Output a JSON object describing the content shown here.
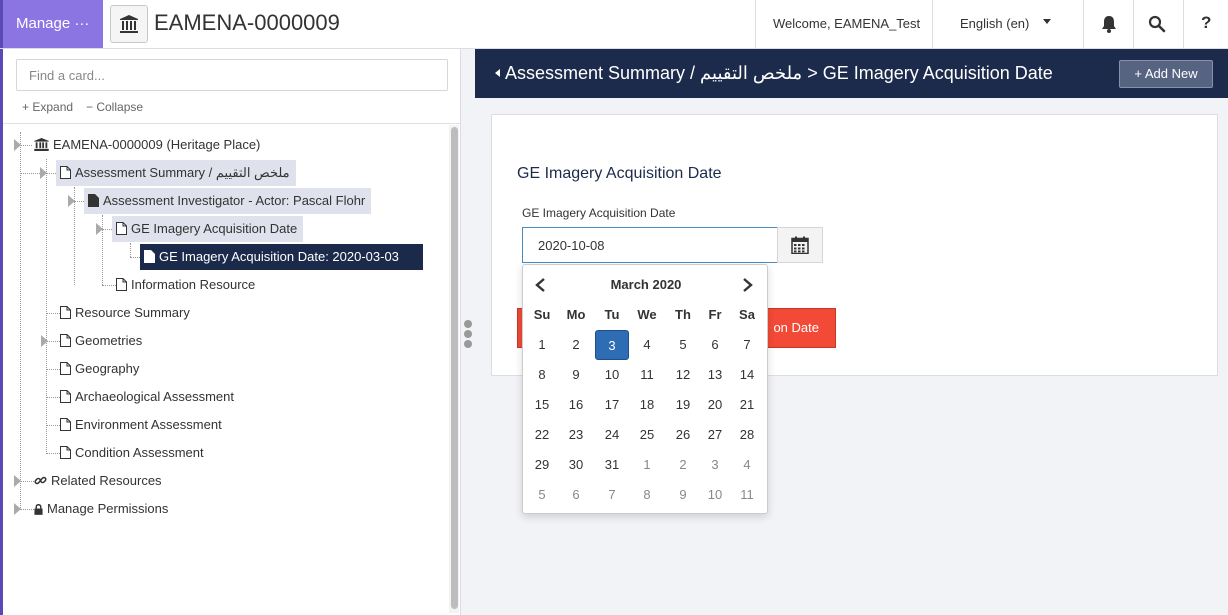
{
  "topbar": {
    "manage_label": "Manage ···",
    "resource_title": "EAMENA-0000009",
    "welcome": "Welcome, EAMENA_Test",
    "language": "English (en)",
    "help": "?"
  },
  "tree": {
    "search_placeholder": "Find a card...",
    "expand_label": "+ Expand",
    "collapse_label": "− Collapse",
    "nodes": [
      {
        "label": "EAMENA-0000009 (Heritage Place)",
        "icon": "building-icon"
      },
      {
        "label": "Assessment Summary / ملخص التقييم",
        "icon": "file-outline-icon"
      },
      {
        "label": "Assessment Investigator - Actor: Pascal Flohr",
        "icon": "file-solid-icon"
      },
      {
        "label": "GE Imagery Acquisition Date",
        "icon": "file-outline-icon"
      },
      {
        "label": "GE Imagery Acquisition Date: 2020-03-03",
        "icon": "file-solid-icon"
      },
      {
        "label": "Information Resource",
        "icon": "file-outline-icon"
      },
      {
        "label": "Resource Summary",
        "icon": "file-outline-icon"
      },
      {
        "label": "Geometries",
        "icon": "file-outline-icon"
      },
      {
        "label": "Geography",
        "icon": "file-outline-icon"
      },
      {
        "label": "Archaeological Assessment",
        "icon": "file-outline-icon"
      },
      {
        "label": "Environment Assessment",
        "icon": "file-outline-icon"
      },
      {
        "label": "Condition Assessment",
        "icon": "file-outline-icon"
      },
      {
        "label": "Related Resources",
        "icon": "link-icon"
      },
      {
        "label": "Manage Permissions",
        "icon": "lock-icon"
      }
    ]
  },
  "editor": {
    "breadcrumb": "Assessment Summary / ملخص التقييم > GE Imagery Acquisition Date",
    "add_new_label": "+ Add New",
    "card_title": "GE Imagery Acquisition Date",
    "field_label": "GE Imagery Acquisition Date",
    "field_value": "2020-10-08",
    "delete_label_visible": "on Date"
  },
  "datepicker": {
    "month_label": "March 2020",
    "weekdays": [
      "Su",
      "Mo",
      "Tu",
      "We",
      "Th",
      "Fr",
      "Sa"
    ],
    "weeks": [
      [
        {
          "d": "1"
        },
        {
          "d": "2"
        },
        {
          "d": "3",
          "active": true
        },
        {
          "d": "4"
        },
        {
          "d": "5"
        },
        {
          "d": "6"
        },
        {
          "d": "7"
        }
      ],
      [
        {
          "d": "8"
        },
        {
          "d": "9"
        },
        {
          "d": "10"
        },
        {
          "d": "11"
        },
        {
          "d": "12"
        },
        {
          "d": "13"
        },
        {
          "d": "14"
        }
      ],
      [
        {
          "d": "15"
        },
        {
          "d": "16"
        },
        {
          "d": "17"
        },
        {
          "d": "18"
        },
        {
          "d": "19"
        },
        {
          "d": "20"
        },
        {
          "d": "21"
        }
      ],
      [
        {
          "d": "22"
        },
        {
          "d": "23"
        },
        {
          "d": "24"
        },
        {
          "d": "25"
        },
        {
          "d": "26"
        },
        {
          "d": "27"
        },
        {
          "d": "28"
        }
      ],
      [
        {
          "d": "29"
        },
        {
          "d": "30"
        },
        {
          "d": "31"
        },
        {
          "d": "1",
          "other": true
        },
        {
          "d": "2",
          "other": true
        },
        {
          "d": "3",
          "other": true
        },
        {
          "d": "4",
          "other": true
        }
      ],
      [
        {
          "d": "5",
          "other": true
        },
        {
          "d": "6",
          "other": true
        },
        {
          "d": "7",
          "other": true
        },
        {
          "d": "8",
          "other": true
        },
        {
          "d": "9",
          "other": true
        },
        {
          "d": "10",
          "other": true
        },
        {
          "d": "11",
          "other": true
        }
      ]
    ]
  },
  "colors": {
    "manage_purple": "#8a75e3",
    "header_navy": "#1c2b4b",
    "selected_node": "#1b2a4a",
    "active_day": "#2e6db3",
    "delete_red": "#f24a36"
  }
}
